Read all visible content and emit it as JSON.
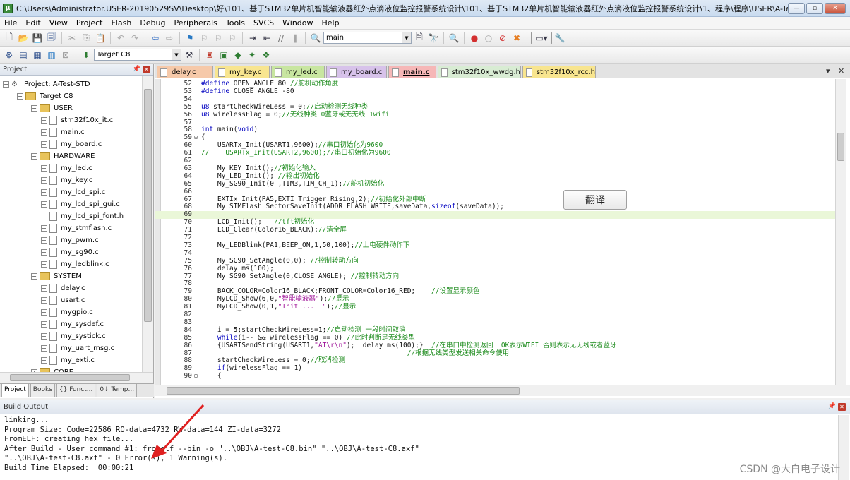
{
  "window": {
    "title": "C:\\Users\\Administrator.USER-20190529SV\\Desktop\\好\\101、基于STM32单片机智能输液器红外点滴液位监控报警系统设计\\101、基于STM32单片机智能输液器红外点滴液位监控报警系统设计\\1、程序\\程序\\USER\\A-Test-STD.uvproj...",
    "controls": [
      "—",
      "▫",
      "✕"
    ]
  },
  "menu": [
    "File",
    "Edit",
    "View",
    "Project",
    "Flash",
    "Debug",
    "Peripherals",
    "Tools",
    "SVCS",
    "Window",
    "Help"
  ],
  "toolbar": {
    "search_value": "main",
    "target_value": "Target C8"
  },
  "project_panel": {
    "title": "Project",
    "tree": [
      {
        "label": "Project: A-Test-STD",
        "kind": "project",
        "level": 0,
        "toggle": "⊟"
      },
      {
        "label": "Target C8",
        "kind": "group",
        "level": 1,
        "toggle": "⊟"
      },
      {
        "label": "USER",
        "kind": "group",
        "level": 2,
        "toggle": "⊟"
      },
      {
        "label": "stm32f10x_it.c",
        "kind": "file",
        "level": 3,
        "toggle": "⊞"
      },
      {
        "label": "main.c",
        "kind": "file",
        "level": 3,
        "toggle": "⊞"
      },
      {
        "label": "my_board.c",
        "kind": "file",
        "level": 3,
        "toggle": "⊞"
      },
      {
        "label": "HARDWARE",
        "kind": "group",
        "level": 2,
        "toggle": "⊟"
      },
      {
        "label": "my_led.c",
        "kind": "file",
        "level": 3,
        "toggle": "⊞"
      },
      {
        "label": "my_key.c",
        "kind": "file",
        "level": 3,
        "toggle": "⊞"
      },
      {
        "label": "my_lcd_spi.c",
        "kind": "file",
        "level": 3,
        "toggle": "⊞"
      },
      {
        "label": "my_lcd_spi_gui.c",
        "kind": "file",
        "level": 3,
        "toggle": "⊞"
      },
      {
        "label": "my_lcd_spi_font.h",
        "kind": "file",
        "level": 3,
        "toggle": ""
      },
      {
        "label": "my_stmflash.c",
        "kind": "file",
        "level": 3,
        "toggle": "⊞"
      },
      {
        "label": "my_pwm.c",
        "kind": "file",
        "level": 3,
        "toggle": "⊞"
      },
      {
        "label": "my_sg90.c",
        "kind": "file",
        "level": 3,
        "toggle": "⊞"
      },
      {
        "label": "my_ledblink.c",
        "kind": "file",
        "level": 3,
        "toggle": "⊞"
      },
      {
        "label": "SYSTEM",
        "kind": "group",
        "level": 2,
        "toggle": "⊟"
      },
      {
        "label": "delay.c",
        "kind": "file",
        "level": 3,
        "toggle": "⊞"
      },
      {
        "label": "usart.c",
        "kind": "file",
        "level": 3,
        "toggle": "⊞"
      },
      {
        "label": "mygpio.c",
        "kind": "file",
        "level": 3,
        "toggle": "⊞"
      },
      {
        "label": "my_sysdef.c",
        "kind": "file",
        "level": 3,
        "toggle": "⊞"
      },
      {
        "label": "my_systick.c",
        "kind": "file",
        "level": 3,
        "toggle": "⊞"
      },
      {
        "label": "my_uart_msg.c",
        "kind": "file",
        "level": 3,
        "toggle": "⊞"
      },
      {
        "label": "my_exti.c",
        "kind": "file",
        "level": 3,
        "toggle": "⊞"
      },
      {
        "label": "CORE",
        "kind": "group",
        "level": 2,
        "toggle": "⊞"
      }
    ],
    "bottom_tabs": [
      "Project",
      "Books",
      "{} Funct...",
      "0↓ Temp..."
    ]
  },
  "editor": {
    "tabs": [
      {
        "label": "delay.c",
        "color": "#f6c9a9"
      },
      {
        "label": "my_key.c",
        "color": "#f8e58f"
      },
      {
        "label": "my_led.c",
        "color": "#c8e6a0"
      },
      {
        "label": "my_board.c",
        "color": "#d7c2ea"
      },
      {
        "label": "main.c",
        "color": "#f6b7b7",
        "active": true
      },
      {
        "label": "stm32f10x_wwdg.h",
        "color": "#d8ecd3"
      },
      {
        "label": "stm32f10x_rcc.h",
        "color": "#f8e58f"
      }
    ],
    "lines": [
      {
        "n": "52",
        "t": "#define OPEN_ANGLE 80 //舵机动作角度"
      },
      {
        "n": "53",
        "t": "#define CLOSE_ANGLE -80"
      },
      {
        "n": "54",
        "t": ""
      },
      {
        "n": "55",
        "t": "u8 startCheckWireLess = 0;//启动检测无线种类"
      },
      {
        "n": "56",
        "t": "u8 wirelessFlag = 0;//无线种类 0蓝牙或无无线 1wifi"
      },
      {
        "n": "57",
        "t": ""
      },
      {
        "n": "58",
        "t": "int main(void)"
      },
      {
        "n": "59",
        "t": "{",
        "f": "⊟"
      },
      {
        "n": "60",
        "t": "    USARTx_Init(USART1,9600);//串口初始化为9600"
      },
      {
        "n": "61",
        "t": "//    USARTx_Init(USART2,9600);//串口初始化为9600"
      },
      {
        "n": "62",
        "t": ""
      },
      {
        "n": "63",
        "t": "    My_KEY_Init();//初始化输入"
      },
      {
        "n": "64",
        "t": "    My_LED_Init(); //输出初始化"
      },
      {
        "n": "65",
        "t": "    My_SG90_Init(0 ,TIM3,TIM_CH_1);//舵机初始化"
      },
      {
        "n": "66",
        "t": ""
      },
      {
        "n": "67",
        "t": "    EXTIx_Init(PA5,EXTI_Trigger_Rising,2);//初始化外部中断"
      },
      {
        "n": "68",
        "t": "    My_STMFlash_SectorSaveInit(ADDR_FLASH_WRITE,saveData,sizeof(saveData));"
      },
      {
        "n": "69",
        "t": "",
        "hl": true
      },
      {
        "n": "70",
        "t": "    LCD_Init();   //tft初始化"
      },
      {
        "n": "71",
        "t": "    LCD_Clear(Color16_BLACK);//清全屏"
      },
      {
        "n": "72",
        "t": ""
      },
      {
        "n": "73",
        "t": "    My_LEDBlink(PA1,BEEP_ON,1,50,100);//上电硬件动作下"
      },
      {
        "n": "74",
        "t": ""
      },
      {
        "n": "75",
        "t": "    My_SG90_SetAngle(0,0); //控制转动方向"
      },
      {
        "n": "76",
        "t": "    delay_ms(100);"
      },
      {
        "n": "77",
        "t": "    My_SG90_SetAngle(0,CLOSE_ANGLE); //控制转动方向"
      },
      {
        "n": "78",
        "t": ""
      },
      {
        "n": "79",
        "t": "    BACK_COLOR=Color16_BLACK;FRONT_COLOR=Color16_RED;    //设置显示颜色"
      },
      {
        "n": "80",
        "t": "    MyLCD_Show(6,0,\"智能输液器\");//显示"
      },
      {
        "n": "81",
        "t": "    MyLCD_Show(0,1,\"Init ...  \");//显示"
      },
      {
        "n": "82",
        "t": ""
      },
      {
        "n": "83",
        "t": ""
      },
      {
        "n": "84",
        "t": "    i = 5;startCheckWireLess=1;//启动检测 一段时间取消"
      },
      {
        "n": "85",
        "t": "    while(i-- && wirelessFlag == 0) //此时判断是无线类型"
      },
      {
        "n": "86",
        "t": "    {USARTSendString(USART1,\"AT\\r\\n\");  delay_ms(100);}  //在串口中检测返回  OK表示WIFI 否则表示无无线或者蓝牙"
      },
      {
        "n": "87",
        "t": "                                                   //根据无线类型发送相关命令使用"
      },
      {
        "n": "88",
        "t": "    startCheckWireLess = 0;//取消检测"
      },
      {
        "n": "89",
        "t": "    if(wirelessFlag == 1)"
      },
      {
        "n": "90",
        "t": "    {",
        "f": "⊟"
      }
    ],
    "translate_label": "翻译"
  },
  "build_output": {
    "title": "Build Output",
    "lines": [
      "linking...",
      "Program Size: Code=22586 RO-data=4732 RW-data=144 ZI-data=3272",
      "FromELF: creating hex file...",
      "After Build - User command #1: fromelf --bin -o \"..\\OBJ\\A-test-C8.bin\" \"..\\OBJ\\A-test-C8.axf\"",
      "\"..\\OBJ\\A-test-C8.axf\" - 0 Error(s), 1 Warning(s).",
      "Build Time Elapsed:  00:00:21"
    ]
  },
  "watermark": "CSDN @大白电子设计",
  "colors": {
    "annotation_arrow": "#e02020",
    "current_line": "#eaf7d8",
    "comment": "#1a8a1a",
    "keyword": "#0000c0",
    "string": "#a0169a"
  }
}
